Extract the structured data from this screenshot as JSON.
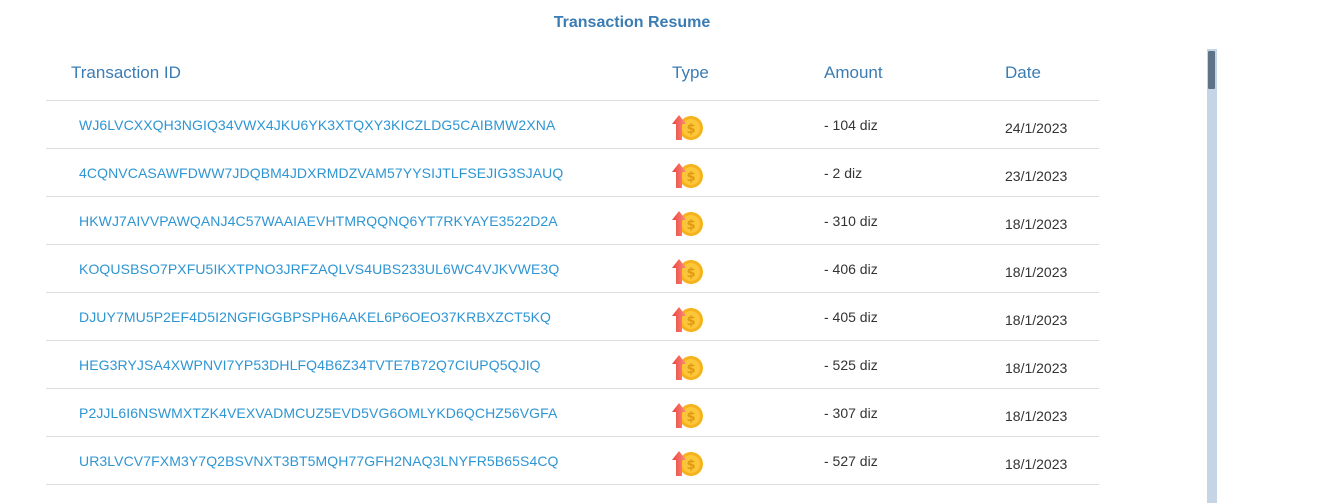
{
  "title": "Transaction Resume",
  "columns": {
    "id": "Transaction ID",
    "type": "Type",
    "amount": "Amount",
    "date": "Date"
  },
  "type_icon": "coin-arrow-up-icon",
  "colors": {
    "accent": "#3b7cb3",
    "link": "#2e95d3",
    "coin": "#f6b21a",
    "arrow": "#f25c5c"
  },
  "transactions": [
    {
      "id": "WJ6LVCXXQH3NGIQ34VWX4JKU6YK3XTQXY3KICZLDG5CAIBMW2XNA",
      "amount": "- 104 diz",
      "date": "24/1/2023"
    },
    {
      "id": "4CQNVCASAWFDWW7JDQBM4JDXRMDZVAM57YYSIJTLFSEJIG3SJAUQ",
      "amount": "- 2 diz",
      "date": "23/1/2023"
    },
    {
      "id": "HKWJ7AIVVPAWQANJ4C57WAAIAEVHTMRQQNQ6YT7RKYAYE3522D2A",
      "amount": "- 310 diz",
      "date": "18/1/2023"
    },
    {
      "id": "KOQUSBSO7PXFU5IKXTPNO3JRFZAQLVS4UBS233UL6WC4VJKVWE3Q",
      "amount": "- 406 diz",
      "date": "18/1/2023"
    },
    {
      "id": "DJUY7MU5P2EF4D5I2NGFIGGBPSPH6AAKEL6P6OEO37KRBXZCT5KQ",
      "amount": "- 405 diz",
      "date": "18/1/2023"
    },
    {
      "id": "HEG3RYJSA4XWPNVI7YP53DHLFQ4B6Z34TVTE7B72Q7CIUPQ5QJIQ",
      "amount": "- 525 diz",
      "date": "18/1/2023"
    },
    {
      "id": "P2JJL6I6NSWMXTZK4VEXVADMCUZ5EVD5VG6OMLYKD6QCHZ56VGFA",
      "amount": "- 307 diz",
      "date": "18/1/2023"
    },
    {
      "id": "UR3LVCV7FXM3Y7Q2BSVNXT3BT5MQH77GFH2NAQ3LNYFR5B65S4CQ",
      "amount": "- 527 diz",
      "date": "18/1/2023"
    }
  ]
}
